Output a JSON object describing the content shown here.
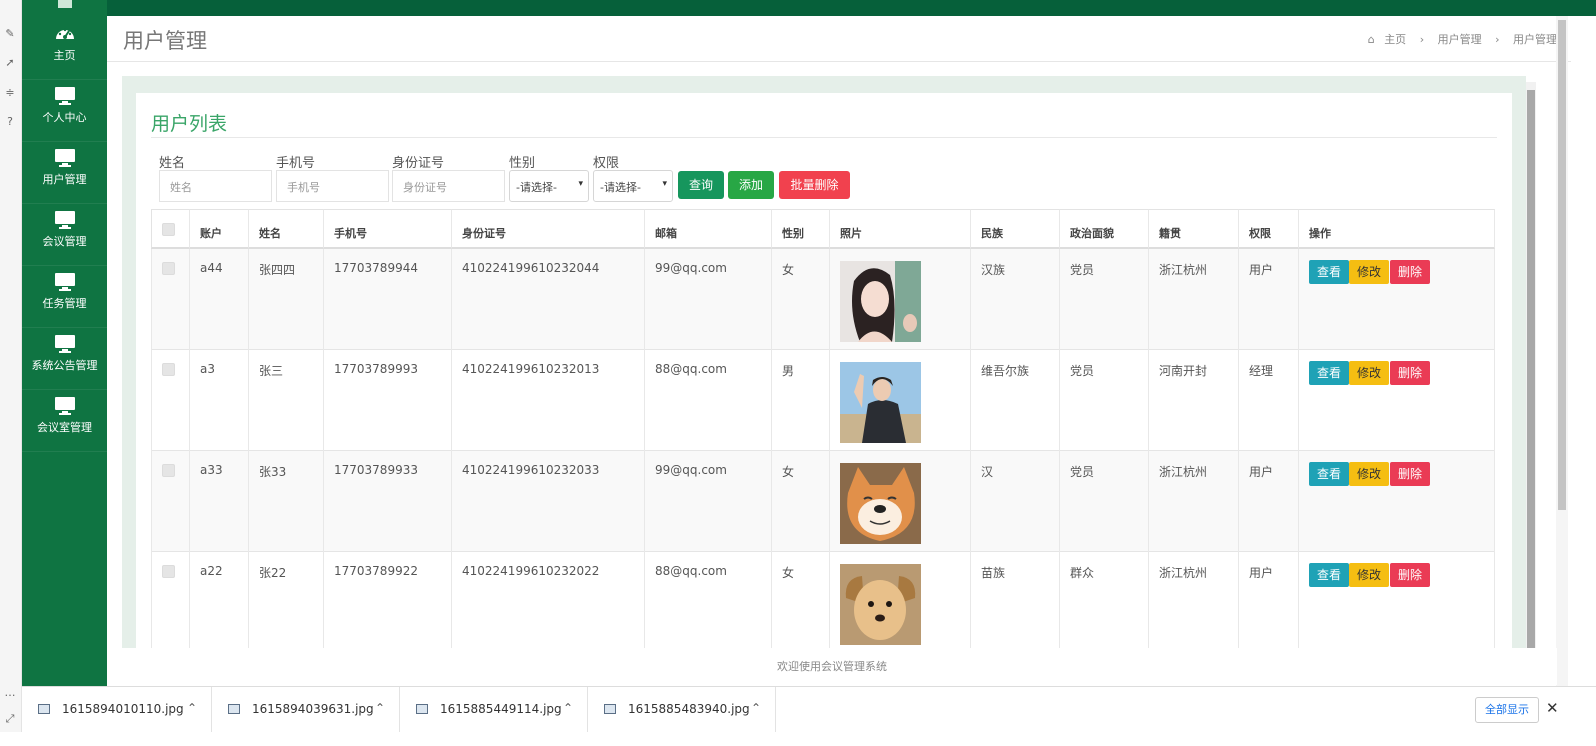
{
  "sidebar": {
    "items": [
      {
        "label": "主页",
        "icon": "dashboard-icon"
      },
      {
        "label": "个人中心",
        "icon": "monitor-icon"
      },
      {
        "label": "用户管理",
        "icon": "monitor-icon"
      },
      {
        "label": "会议管理",
        "icon": "monitor-icon"
      },
      {
        "label": "任务管理",
        "icon": "monitor-icon"
      },
      {
        "label": "系统公告管理",
        "icon": "monitor-icon"
      },
      {
        "label": "会议室管理",
        "icon": "monitor-icon"
      }
    ]
  },
  "header": {
    "title": "用户管理",
    "breadcrumb": [
      "主页",
      "用户管理",
      "用户管理"
    ]
  },
  "card": {
    "title": "用户列表"
  },
  "filters": {
    "name_label": "姓名",
    "name_placeholder": "姓名",
    "phone_label": "手机号",
    "phone_placeholder": "手机号",
    "idcard_label": "身份证号",
    "idcard_placeholder": "身份证号",
    "gender_label": "性别",
    "gender_value": "-请选择-",
    "role_label": "权限",
    "role_value": "-请选择-",
    "query_button": "查询",
    "add_button": "添加",
    "batch_delete_button": "批量删除"
  },
  "table": {
    "headers": [
      "账户",
      "姓名",
      "手机号",
      "身份证号",
      "邮箱",
      "性别",
      "照片",
      "民族",
      "政治面貌",
      "籍贯",
      "权限",
      "操作"
    ],
    "rows": [
      {
        "account": "a44",
        "name": "张四四",
        "phone": "17703789944",
        "idcard": "410224199610232044",
        "email": "99@qq.com",
        "gender": "女",
        "photo": "woman-illustration",
        "ethnicity": "汉族",
        "political": "党员",
        "origin": "浙江杭州",
        "role": "用户"
      },
      {
        "account": "a3",
        "name": "张三",
        "phone": "17703789993",
        "idcard": "410224199610232013",
        "email": "88@qq.com",
        "gender": "男",
        "photo": "young-man-photo",
        "ethnicity": "维吾尔族",
        "political": "党员",
        "origin": "河南开封",
        "role": "经理"
      },
      {
        "account": "a33",
        "name": "张33",
        "phone": "17703789933",
        "idcard": "410224199610232033",
        "email": "99@qq.com",
        "gender": "女",
        "photo": "shiba-dog-photo",
        "ethnicity": "汉",
        "political": "党员",
        "origin": "浙江杭州",
        "role": "用户"
      },
      {
        "account": "a22",
        "name": "张22",
        "phone": "17703789922",
        "idcard": "410224199610232022",
        "email": "88@qq.com",
        "gender": "女",
        "photo": "puppy-photo",
        "ethnicity": "苗族",
        "political": "群众",
        "origin": "浙江杭州",
        "role": "用户"
      }
    ],
    "actions": {
      "view": "查看",
      "edit": "修改",
      "delete": "删除"
    }
  },
  "footer": {
    "text": "欢迎使用会议管理系统"
  },
  "downloads": {
    "files": [
      "1615894010110.jpg",
      "1615894039631.jpg",
      "1615885449114.jpg",
      "1615885483940.jpg"
    ],
    "show_all": "全部显示"
  },
  "colors": {
    "sidebar": "#0f7442",
    "topbar": "#06603a",
    "title_green": "#3aa568",
    "query_button": "#16965d",
    "add_button": "#28a745",
    "delete_button": "#f1414e",
    "view_button": "#1fa2b6",
    "edit_button": "#f5be12"
  }
}
